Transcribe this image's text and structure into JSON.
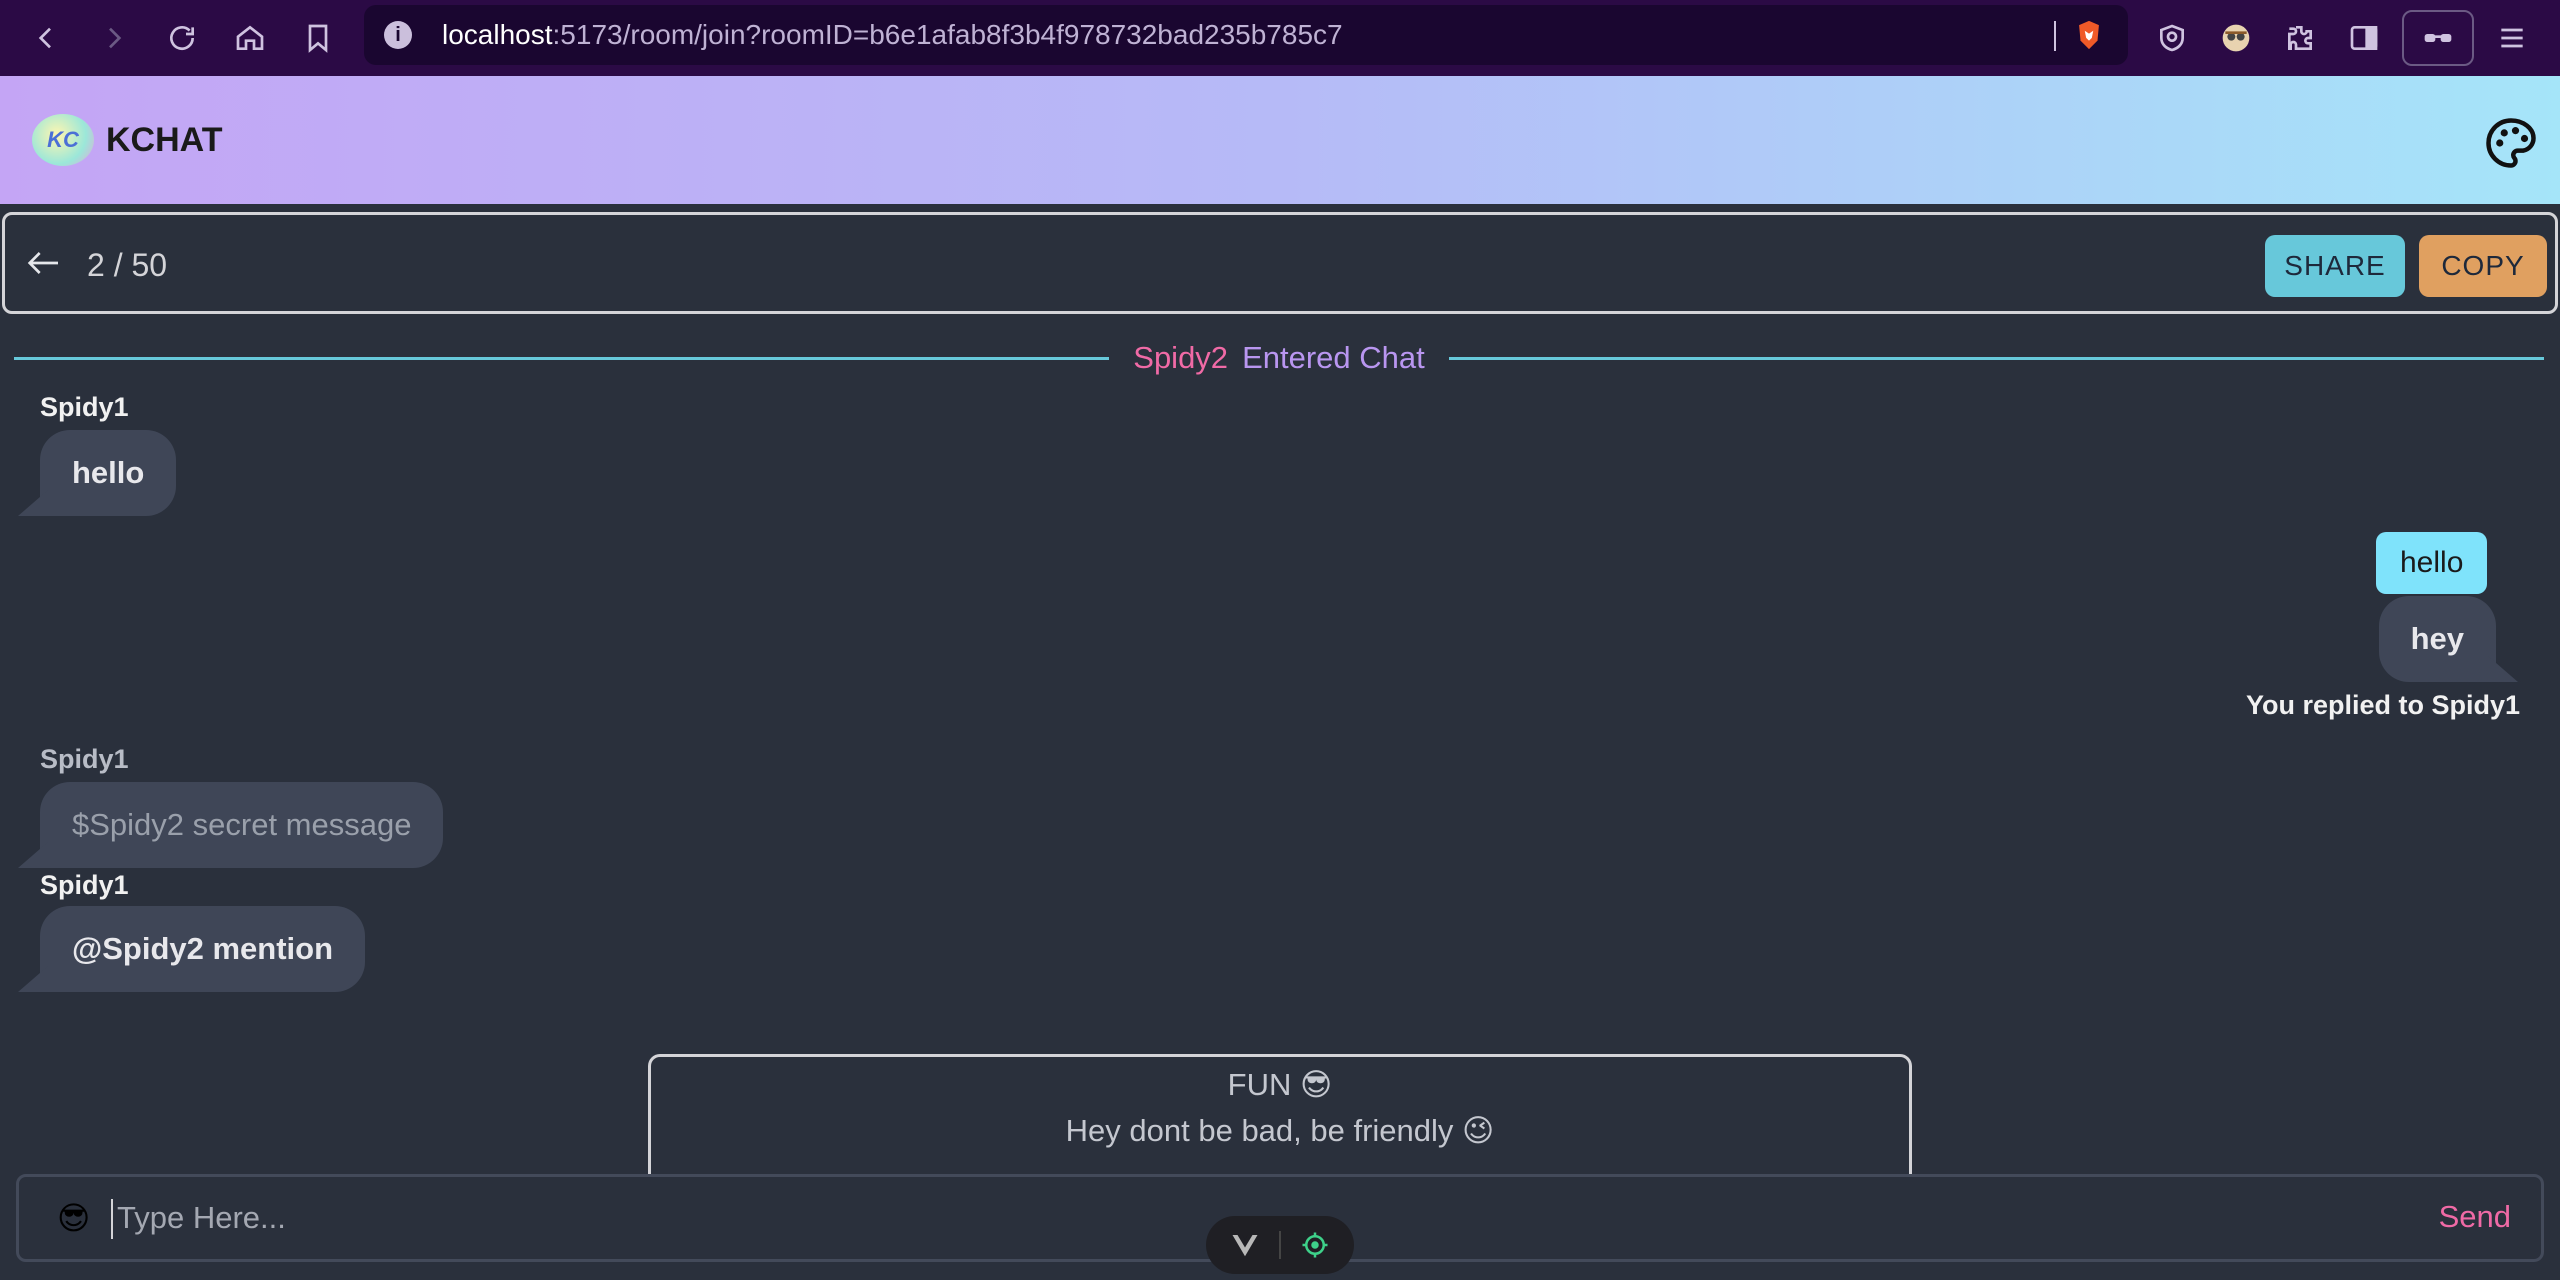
{
  "browser": {
    "url_host": "localhost",
    "url_rest": ":5173/room/join?roomID=b6e1afab8f3b4f978732bad235b785c7"
  },
  "app": {
    "title": "KCHAT",
    "logo_text": "KC"
  },
  "room": {
    "count": "2 / 50",
    "share_label": "SHARE",
    "copy_label": "COPY"
  },
  "event": {
    "user": "Spidy2",
    "text": "Entered Chat"
  },
  "messages": [
    {
      "sender": "Spidy1",
      "text": "hello",
      "side": "left"
    },
    {
      "reply_quote": "hello",
      "text": "hey",
      "side": "right",
      "note": "You replied to Spidy1"
    },
    {
      "sender": "Spidy1",
      "text": "$Spidy2 secret message",
      "side": "left"
    },
    {
      "sender": "Spidy1",
      "text": "@Spidy2 mention",
      "side": "left"
    }
  ],
  "fun_card": {
    "title": "FUN 😎",
    "text": "Hey dont be bad, be friendly 😉"
  },
  "composer": {
    "emoji": "😎",
    "placeholder": "Type Here...",
    "send_label": "Send"
  },
  "colors": {
    "accent_cyan": "#67c8da",
    "accent_orange": "#e0a060",
    "accent_pink": "#f06aa6",
    "accent_purple": "#b996f0",
    "bubble": "#3f4657",
    "background": "#2a303c"
  }
}
